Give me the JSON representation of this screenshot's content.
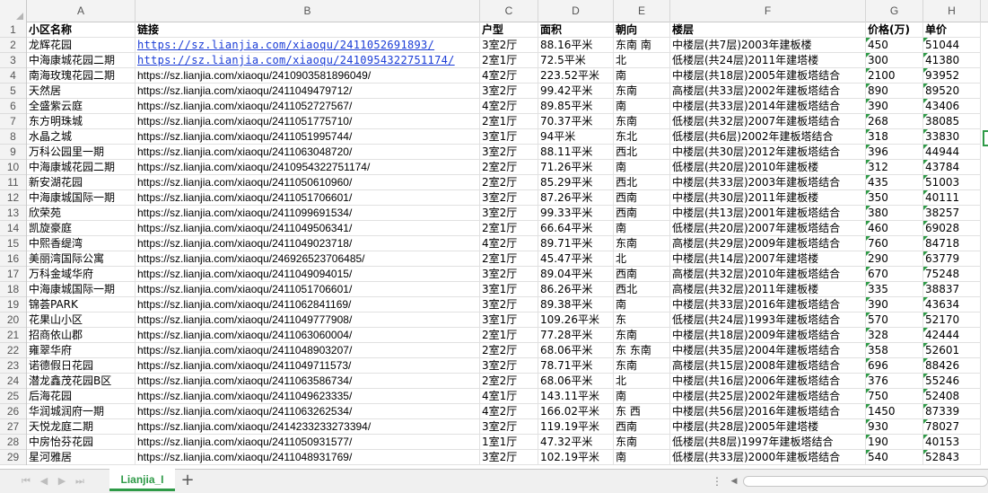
{
  "columns": [
    "A",
    "B",
    "C",
    "D",
    "E",
    "F",
    "G",
    "H"
  ],
  "header": [
    "小区名称",
    "链接",
    "户型",
    "面积",
    "朝向",
    "楼层",
    "价格(万)",
    "单价"
  ],
  "rows": [
    [
      "龙辉花园",
      "https://sz.lianjia.com/xiaoqu/2411052691893/",
      "3室2厅",
      "88.16平米",
      "东南 南",
      "中楼层(共7层)2003年建板楼",
      "450",
      "51044"
    ],
    [
      "中海康城花园二期",
      "https://sz.lianjia.com/xiaoqu/2410954322751174/",
      "2室1厅",
      "72.5平米",
      "北",
      "低楼层(共24层)2011年建塔楼",
      "300",
      "41380"
    ],
    [
      "南海玫瑰花园二期",
      "https://sz.lianjia.com/xiaoqu/2410903581896049/",
      "4室2厅",
      "223.52平米",
      "南",
      "中楼层(共18层)2005年建板塔结合",
      "2100",
      "93952"
    ],
    [
      "天然居",
      "https://sz.lianjia.com/xiaoqu/2411049479712/",
      "3室2厅",
      "99.42平米",
      "东南",
      "高楼层(共33层)2002年建板塔结合",
      "890",
      "89520"
    ],
    [
      "全盛紫云庭",
      "https://sz.lianjia.com/xiaoqu/2411052727567/",
      "4室2厅",
      "89.85平米",
      "南",
      "中楼层(共33层)2014年建板塔结合",
      "390",
      "43406"
    ],
    [
      "东方明珠城",
      "https://sz.lianjia.com/xiaoqu/2411051775710/",
      "2室1厅",
      "70.37平米",
      "东南",
      "低楼层(共32层)2007年建板塔结合",
      "268",
      "38085"
    ],
    [
      "水晶之城",
      "https://sz.lianjia.com/xiaoqu/2411051995744/",
      "3室1厅",
      "94平米",
      "东北",
      "低楼层(共6层)2002年建板塔结合",
      "318",
      "33830"
    ],
    [
      "万科公园里一期",
      "https://sz.lianjia.com/xiaoqu/2411063048720/",
      "3室2厅",
      "88.11平米",
      "西北",
      "中楼层(共30层)2012年建板塔结合",
      "396",
      "44944"
    ],
    [
      "中海康城花园二期",
      "https://sz.lianjia.com/xiaoqu/2410954322751174/",
      "2室2厅",
      "71.26平米",
      "南",
      "低楼层(共20层)2010年建板楼",
      "312",
      "43784"
    ],
    [
      "新安湖花园",
      "https://sz.lianjia.com/xiaoqu/2411050610960/",
      "2室2厅",
      "85.29平米",
      "西北",
      "中楼层(共33层)2003年建板塔结合",
      "435",
      "51003"
    ],
    [
      "中海康城国际一期",
      "https://sz.lianjia.com/xiaoqu/2411051706601/",
      "3室2厅",
      "87.26平米",
      "西南",
      "中楼层(共30层)2011年建板楼",
      "350",
      "40111"
    ],
    [
      "欣荣苑",
      "https://sz.lianjia.com/xiaoqu/2411099691534/",
      "3室2厅",
      "99.33平米",
      "西南",
      "中楼层(共13层)2001年建板塔结合",
      "380",
      "38257"
    ],
    [
      "凯旋豪庭",
      "https://sz.lianjia.com/xiaoqu/2411049506341/",
      "2室1厅",
      "66.64平米",
      "南",
      "低楼层(共20层)2007年建板塔结合",
      "460",
      "69028"
    ],
    [
      "中熙香缇湾",
      "https://sz.lianjia.com/xiaoqu/2411049023718/",
      "4室2厅",
      "89.71平米",
      "东南",
      "高楼层(共29层)2009年建板塔结合",
      "760",
      "84718"
    ],
    [
      "美丽湾国际公寓",
      "https://sz.lianjia.com/xiaoqu/246926523706485/",
      "2室1厅",
      "45.47平米",
      "北",
      "中楼层(共14层)2007年建塔楼",
      "290",
      "63779"
    ],
    [
      "万科金域华府",
      "https://sz.lianjia.com/xiaoqu/2411049094015/",
      "3室2厅",
      "89.04平米",
      "西南",
      "高楼层(共32层)2010年建板塔结合",
      "670",
      "75248"
    ],
    [
      "中海康城国际一期",
      "https://sz.lianjia.com/xiaoqu/2411051706601/",
      "3室1厅",
      "86.26平米",
      "西北",
      "高楼层(共32层)2011年建板楼",
      "335",
      "38837"
    ],
    [
      "锦荟PARK",
      "https://sz.lianjia.com/xiaoqu/2411062841169/",
      "3室2厅",
      "89.38平米",
      "南",
      "中楼层(共33层)2016年建板塔结合",
      "390",
      "43634"
    ],
    [
      "花果山小区",
      "https://sz.lianjia.com/xiaoqu/2411049777908/",
      "3室1厅",
      "109.26平米",
      "东",
      "低楼层(共24层)1993年建板塔结合",
      "570",
      "52170"
    ],
    [
      "招商依山郡",
      "https://sz.lianjia.com/xiaoqu/2411063060004/",
      "2室1厅",
      "77.28平米",
      "东南",
      "中楼层(共18层)2009年建板塔结合",
      "328",
      "42444"
    ],
    [
      "雍翠华府",
      "https://sz.lianjia.com/xiaoqu/2411048903207/",
      "2室2厅",
      "68.06平米",
      "东 东南",
      "中楼层(共35层)2004年建板塔结合",
      "358",
      "52601"
    ],
    [
      "诺德假日花园",
      "https://sz.lianjia.com/xiaoqu/2411049711573/",
      "3室2厅",
      "78.71平米",
      "东南",
      "高楼层(共15层)2008年建板塔结合",
      "696",
      "88426"
    ],
    [
      "潜龙鑫茂花园B区",
      "https://sz.lianjia.com/xiaoqu/2411063586734/",
      "2室2厅",
      "68.06平米",
      "北",
      "中楼层(共16层)2006年建板塔结合",
      "376",
      "55246"
    ],
    [
      "后海花园",
      "https://sz.lianjia.com/xiaoqu/2411049623335/",
      "4室1厅",
      "143.11平米",
      "南",
      "中楼层(共25层)2002年建板塔结合",
      "750",
      "52408"
    ],
    [
      "华润城润府一期",
      "https://sz.lianjia.com/xiaoqu/2411063262534/",
      "4室2厅",
      "166.02平米",
      "东 西",
      "中楼层(共56层)2016年建板塔结合",
      "1450",
      "87339"
    ],
    [
      "天悦龙庭二期",
      "https://sz.lianjia.com/xiaoqu/2414233233273394/",
      "3室2厅",
      "119.19平米",
      "西南",
      "中楼层(共28层)2005年建塔楼",
      "930",
      "78027"
    ],
    [
      "中房怡芬花园",
      "https://sz.lianjia.com/xiaoqu/2411050931577/",
      "1室1厅",
      "47.32平米",
      "东南",
      "低楼层(共8层)1997年建板塔结合",
      "190",
      "40153"
    ],
    [
      "星河雅居",
      "https://sz.lianjia.com/xiaoqu/2411048931769/",
      "3室2厅",
      "102.19平米",
      "南",
      "低楼层(共33层)2000年建板塔结合",
      "540",
      "52843"
    ]
  ],
  "sheet_tab": "Lianjia_I",
  "accent": "#2e9a47",
  "link_color": "#1a3cd6"
}
